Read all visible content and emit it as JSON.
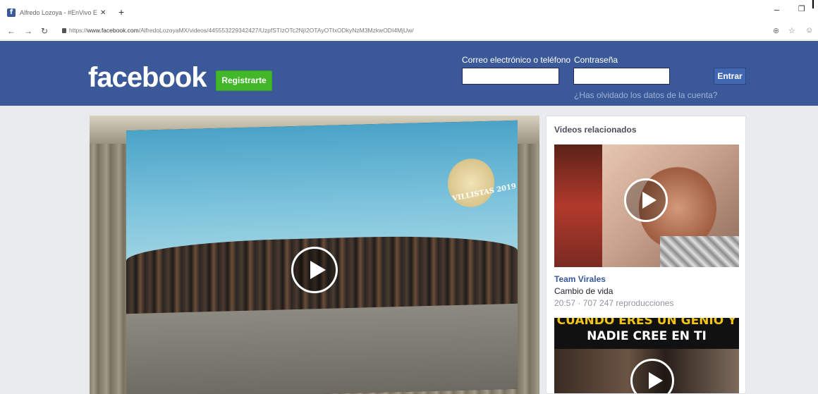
{
  "browser": {
    "tab_title": "Alfredo Lozoya - #EnVivo Estoy ...",
    "tab_close": "✕",
    "new_tab": "+",
    "url_prefix": "https://",
    "url_host": "www.facebook.com",
    "url_path": "/AlfredoLozoyaMX/videos/445553229342427/UzpfSTIzOTc2NjI2OTAyOTIxODkyNzM3MzkwODI4MjUw/"
  },
  "header": {
    "logo": "facebook",
    "register_label": "Registrarte",
    "email_label": "Correo electrónico o teléfono",
    "password_label": "Contraseña",
    "login_label": "Entrar",
    "forgot_label": "¿Has olvidado los datos de la cuenta?",
    "brand_color": "#3b5998"
  },
  "video": {
    "overlay_text": "VILLISTAS 2019"
  },
  "sidebar": {
    "title": "Videos relacionados",
    "items": [
      {
        "author": "Team Virales",
        "title": "Cambio de vida",
        "meta": "20:57 · 707 247 reproducciones"
      },
      {
        "caption_top": "CUANDO ERES UN GENIO Y",
        "caption_bottom": "NADIE CREE EN TI"
      }
    ]
  }
}
